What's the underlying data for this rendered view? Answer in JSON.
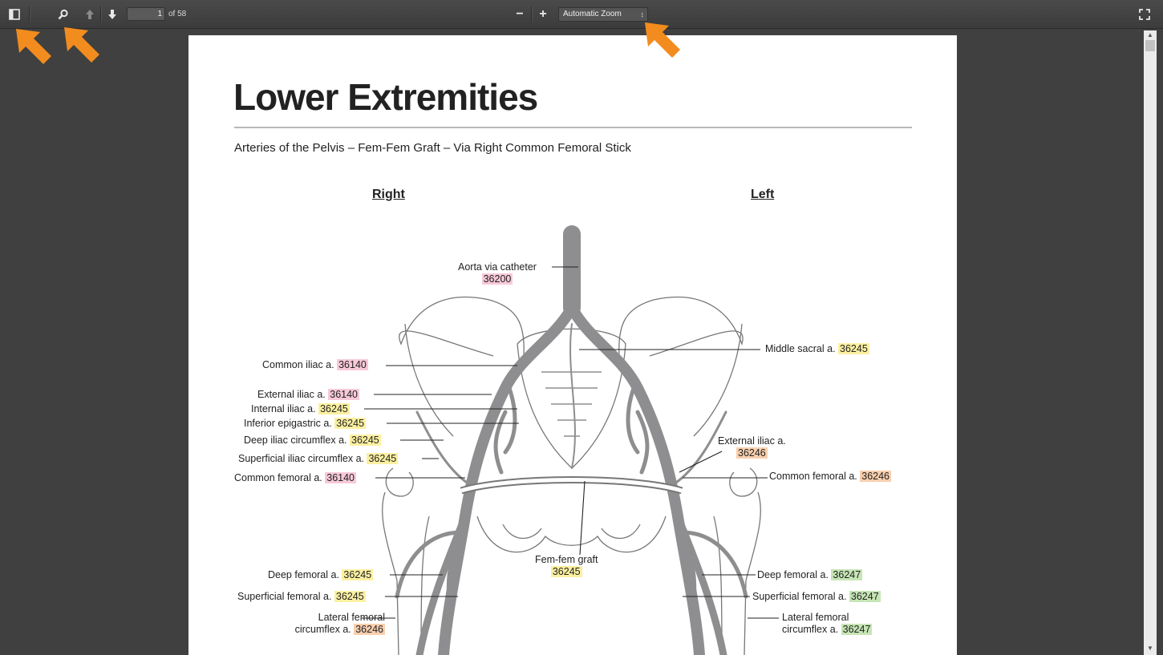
{
  "toolbar": {
    "page_number": "1",
    "page_count": "of 58",
    "zoom_label": "Automatic Zoom",
    "zoom_caret": "↕",
    "zoom_out_glyph": "−",
    "zoom_in_glyph": "+"
  },
  "colors": {
    "toolbar": "#404040",
    "arrow": "#f28c1e",
    "vessel": "#8e8e90",
    "code_pink": "#f7c9d9",
    "code_yellow": "#fbf0a1",
    "code_orange": "#f8cfae",
    "code_green": "#c6e5b5"
  },
  "document": {
    "title": "Lower Extremities",
    "subtitle": "Arteries of the Pelvis – Fem-Fem Graft – Via Right Common Femoral Stick",
    "right_heading": "Right",
    "left_heading": "Left",
    "labels": {
      "aorta": {
        "text": "Aorta via catheter",
        "code": "36200"
      },
      "middle_sacral": {
        "text": "Middle sacral a.",
        "code": "36245"
      },
      "common_iliac_r": {
        "text": "Common iliac a.",
        "code": "36140"
      },
      "external_iliac_r": {
        "text": "External iliac a.",
        "code": "36140"
      },
      "internal_iliac_r": {
        "text": "Internal iliac a.",
        "code": "36245"
      },
      "inferior_epigastric_r": {
        "text": "Inferior epigastric a.",
        "code": "36245"
      },
      "deep_iliac_circumflex_r": {
        "text": "Deep iliac circumflex a.",
        "code": "36245"
      },
      "superficial_iliac_circumflex_r": {
        "text": "Superficial iliac circumflex a.",
        "code": "36245"
      },
      "common_femoral_r": {
        "text": "Common femoral a.",
        "code": "36140"
      },
      "external_iliac_l": {
        "text": "External iliac a.",
        "code": "36246"
      },
      "common_femoral_l": {
        "text": "Common femoral a.",
        "code": "36246"
      },
      "fem_fem_graft": {
        "text": "Fem-fem graft",
        "code": "36245"
      },
      "deep_femoral_r": {
        "text": "Deep femoral a.",
        "code": "36245"
      },
      "superficial_femoral_r": {
        "text": "Superficial femoral a.",
        "code": "36245"
      },
      "lateral_femoral_r": {
        "text1": "Lateral femoral",
        "text2": "circumflex a.",
        "code": "36246"
      },
      "deep_femoral_l": {
        "text": "Deep femoral a.",
        "code": "36247"
      },
      "superficial_femoral_l": {
        "text": "Superficial femoral a.",
        "code": "36247"
      },
      "lateral_femoral_l": {
        "text1": "Lateral femoral",
        "text2": "circumflex a.",
        "code": "36247"
      }
    }
  }
}
